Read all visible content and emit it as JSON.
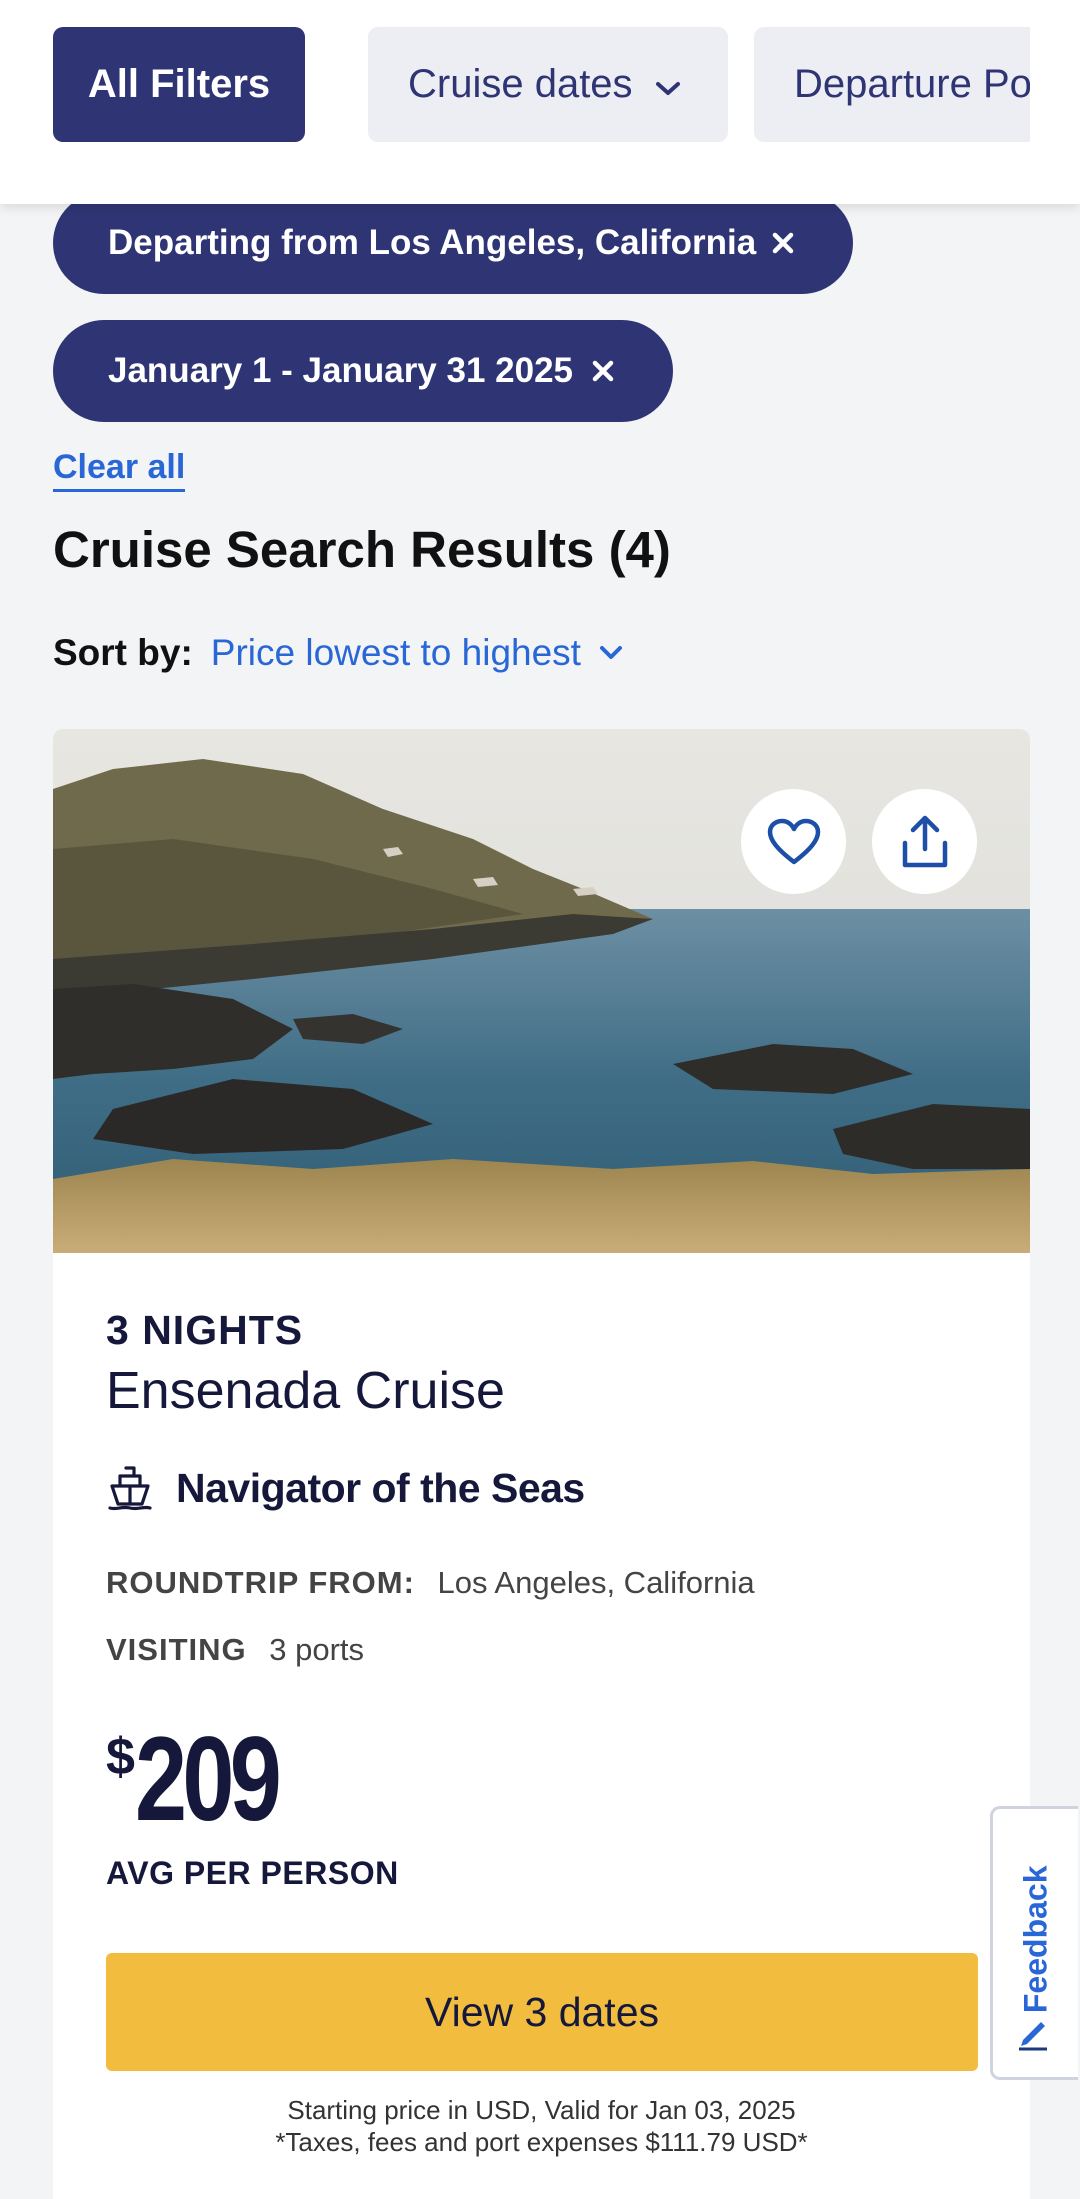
{
  "filter_bar": {
    "all_filters": "All Filters",
    "cruise_dates": "Cruise dates",
    "departure_port": "Departure Po"
  },
  "chips": [
    {
      "label": "Departing from Los Angeles, California"
    },
    {
      "label": "January 1 - January 31 2025"
    }
  ],
  "clear_all": "Clear all",
  "results": {
    "title": "Cruise Search Results (4)",
    "sort_label": "Sort by:",
    "sort_value": "Price lowest to highest"
  },
  "card": {
    "nights": "3 NIGHTS",
    "name": "Ensenada Cruise",
    "ship": "Navigator of the Seas",
    "roundtrip_label": "ROUNDTRIP FROM:",
    "roundtrip_value": "Los Angeles, California",
    "visiting_label": "VISITING",
    "visiting_value": "3 ports",
    "price_currency": "$",
    "price_amount": "209",
    "price_note": "AVG PER PERSON",
    "cta": "View 3 dates",
    "fine_print_1": "Starting price in USD, Valid for Jan 03, 2025",
    "fine_print_2": "*Taxes, fees and port expenses $111.79 USD*"
  },
  "feedback": "Feedback",
  "colors": {
    "navy": "#2f3574",
    "link_blue": "#2a67d6",
    "cta_yellow": "#f2bd3e",
    "background": "#f3f4f6"
  },
  "icons": [
    "chevron-down-icon",
    "close-icon",
    "heart-icon",
    "share-icon",
    "ship-icon",
    "pencil-icon"
  ]
}
